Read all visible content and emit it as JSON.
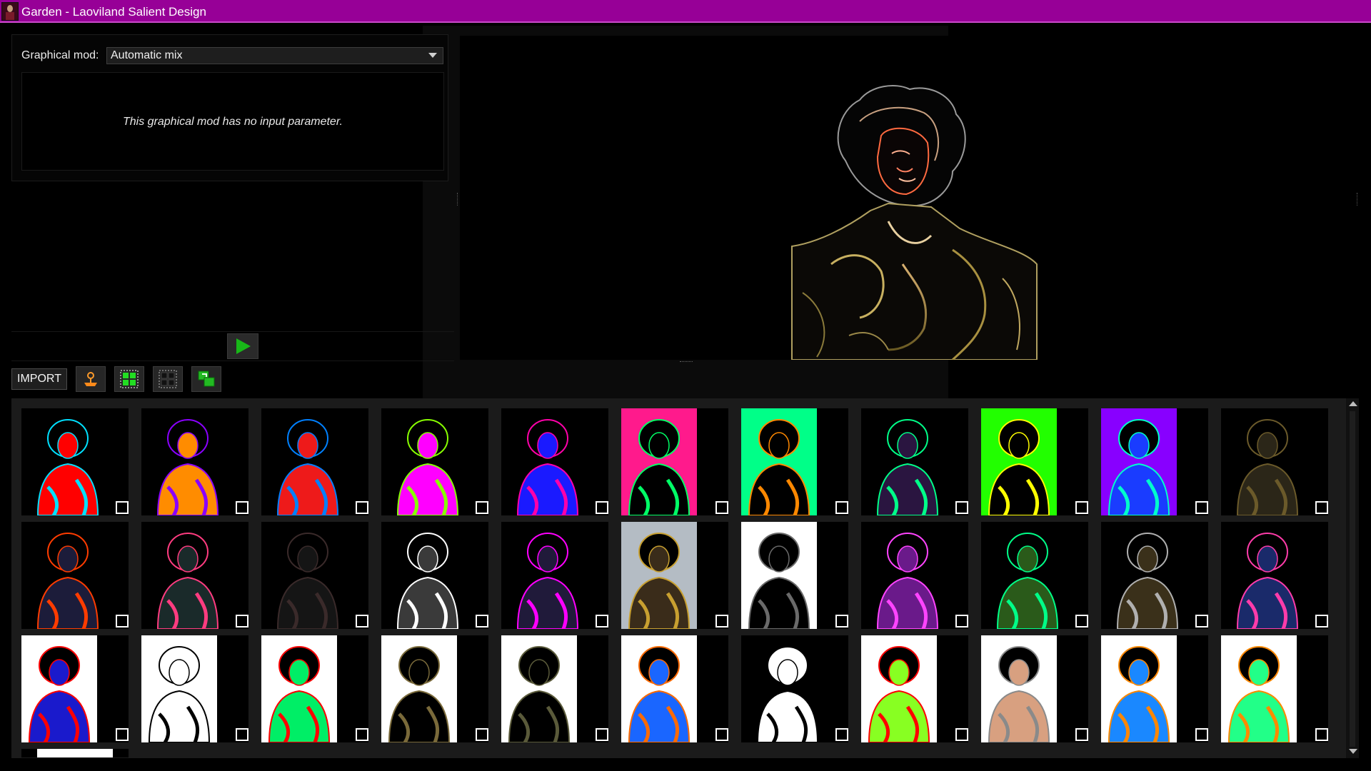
{
  "window": {
    "title": "Garden - Laoviland Salient Design"
  },
  "controls": {
    "graphical_mod_label": "Graphical mod:",
    "graphical_mod_value": "Automatic mix",
    "no_param_message": "This graphical mod has no input parameter."
  },
  "toolbar": {
    "import_label": "IMPORT",
    "icons": [
      "palette-icon",
      "grid-select-all-icon",
      "grid-deselect-icon",
      "swap-images-icon"
    ]
  },
  "gallery": {
    "selected_index": 10,
    "thumbnails": [
      {
        "bg": "#000000",
        "fill": "#ff0000",
        "accent": "#00e0ff",
        "wide": true
      },
      {
        "bg": "#000000",
        "fill": "#ff8c00",
        "accent": "#8a00ff",
        "wide": true
      },
      {
        "bg": "#000000",
        "fill": "#ee1a1a",
        "accent": "#0080ff",
        "wide": true
      },
      {
        "bg": "#000000",
        "fill": "#ff00ff",
        "accent": "#88ff00",
        "wide": true
      },
      {
        "bg": "#000000",
        "fill": "#1a1aff",
        "accent": "#ff00aa",
        "wide": true
      },
      {
        "bg": "#ff1a8c",
        "fill": "#000000",
        "accent": "#00ff66",
        "wide": false
      },
      {
        "bg": "#00ff88",
        "fill": "#000000",
        "accent": "#ff8800",
        "wide": false
      },
      {
        "bg": "#000000",
        "fill": "#2a1540",
        "accent": "#00ff88",
        "wide": true
      },
      {
        "bg": "#22ff00",
        "fill": "#000000",
        "accent": "#ffff00",
        "wide": false
      },
      {
        "bg": "#8800ff",
        "fill": "#1a3cff",
        "accent": "#00ffcc",
        "wide": false
      },
      {
        "bg": "#000000",
        "fill": "#2b2618",
        "accent": "#6b5a2a",
        "wide": true
      },
      {
        "bg": "#000000",
        "fill": "#1c1c3a",
        "accent": "#ff3c00",
        "wide": true
      },
      {
        "bg": "#000000",
        "fill": "#1a2a2a",
        "accent": "#ff3c80",
        "wide": true
      },
      {
        "bg": "#000000",
        "fill": "#151515",
        "accent": "#3a2a2a",
        "wide": true
      },
      {
        "bg": "#000000",
        "fill": "#3a3a3a",
        "accent": "#ffffff",
        "wide": true
      },
      {
        "bg": "#000000",
        "fill": "#201a3a",
        "accent": "#ff00ff",
        "wide": true
      },
      {
        "bg": "#b4bcc4",
        "fill": "#3a2c1a",
        "accent": "#c8a030",
        "wide": false
      },
      {
        "bg": "#ffffff",
        "fill": "#000000",
        "accent": "#6a6a6a",
        "wide": false
      },
      {
        "bg": "#000000",
        "fill": "#6a1a8a",
        "accent": "#ff44ff",
        "wide": true
      },
      {
        "bg": "#000000",
        "fill": "#2a5a1a",
        "accent": "#00ff88",
        "wide": true
      },
      {
        "bg": "#000000",
        "fill": "#3a301a",
        "accent": "#b0b0b0",
        "wide": true
      },
      {
        "bg": "#000000",
        "fill": "#1a2a6a",
        "accent": "#ff3caa",
        "wide": true
      },
      {
        "bg": "#ffffff",
        "fill": "#1a1acc",
        "accent": "#ff0000",
        "wide": false
      },
      {
        "bg": "#ffffff",
        "fill": "#ffffff",
        "accent": "#000000",
        "wide": false
      },
      {
        "bg": "#ffffff",
        "fill": "#00ee66",
        "accent": "#ff0000",
        "wide": false
      },
      {
        "bg": "#ffffff",
        "fill": "#000000",
        "accent": "#7a6a3a",
        "wide": false
      },
      {
        "bg": "#ffffff",
        "fill": "#000000",
        "accent": "#5a5a3a",
        "wide": false
      },
      {
        "bg": "#ffffff",
        "fill": "#1a66ff",
        "accent": "#ff6a00",
        "wide": false
      },
      {
        "bg": "#000000",
        "fill": "#ffffff",
        "accent": "#000000",
        "wide": true
      },
      {
        "bg": "#ffffff",
        "fill": "#88ff22",
        "accent": "#ff0000",
        "wide": false
      },
      {
        "bg": "#ffffff",
        "fill": "#d8a080",
        "accent": "#8a8a8a",
        "wide": false
      },
      {
        "bg": "#ffffff",
        "fill": "#1a88ff",
        "accent": "#ff8800",
        "wide": false
      },
      {
        "bg": "#ffffff",
        "fill": "#22ff88",
        "accent": "#ff8800",
        "wide": false
      }
    ]
  },
  "colors": {
    "titlebar": "#970097",
    "accent_play": "#18b818",
    "panel_bg": "#1b1b1b"
  }
}
